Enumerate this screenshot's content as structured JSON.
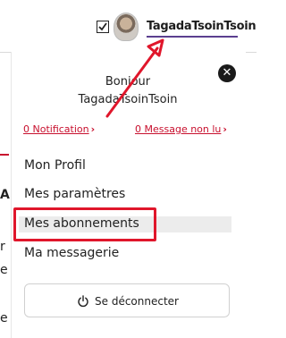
{
  "header": {
    "username": "TagadaTsoinTsoin",
    "underline_color": "#5b3f8f",
    "checkbox_checked": true
  },
  "background": {
    "edge_chars": [
      "A",
      "r",
      "e",
      "e"
    ]
  },
  "panel": {
    "close_icon": "close-icon",
    "greeting_line1": "Bonjour",
    "greeting_line2": "TagadaTsoinTsoin",
    "notification_link": "0 Notification",
    "message_link": "0 Message non lu",
    "menu": [
      {
        "label": "Mon Profil"
      },
      {
        "label": "Mes paramètres"
      },
      {
        "label": "Mes abonnements",
        "highlighted": true
      },
      {
        "label": "Ma messagerie"
      }
    ],
    "logout_label": "Se déconnecter",
    "logout_icon": "power-icon",
    "link_color": "#c8102e",
    "annotation_color": "#e0162b"
  }
}
